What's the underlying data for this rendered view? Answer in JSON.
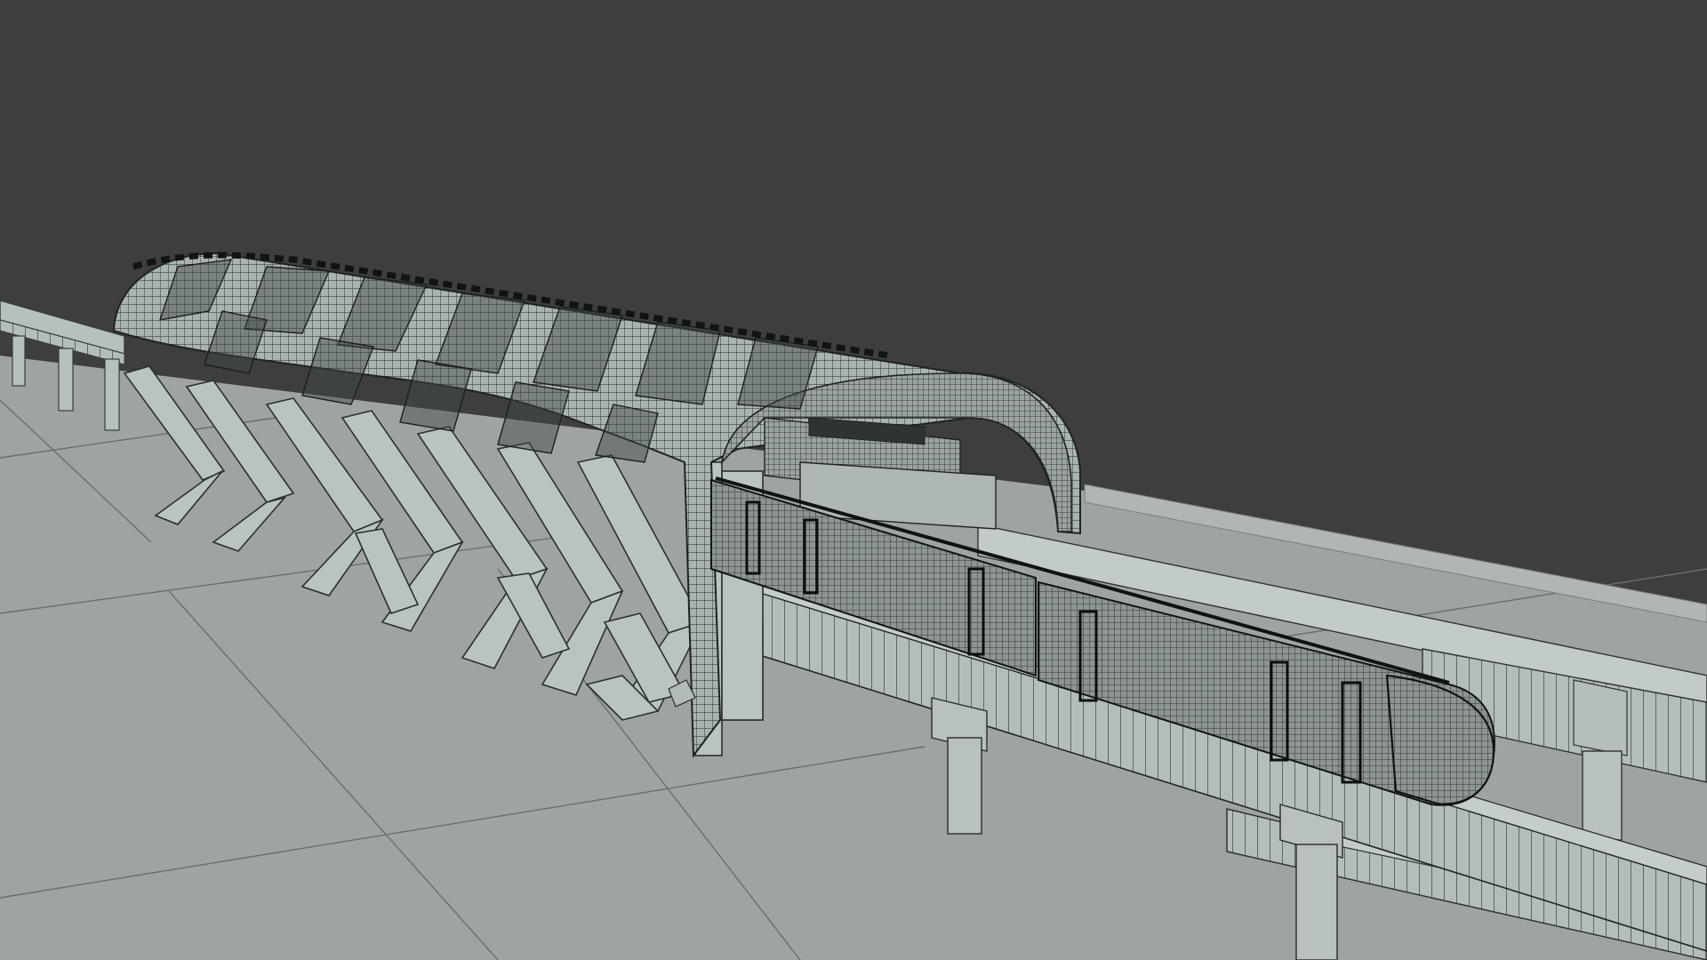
{
  "scene": {
    "background_color": "#3e3e3e",
    "ground_color": "#9ea2a2",
    "structure_color": "#b8c2bf",
    "wire_color": "#2a2f2f",
    "train_color": "#8f9896",
    "render_mode": "wireframe-on-shaded",
    "subjects": [
      "station-canopy",
      "elevated-viaduct",
      "monorail-train",
      "support-piers",
      "ground-plane"
    ]
  }
}
